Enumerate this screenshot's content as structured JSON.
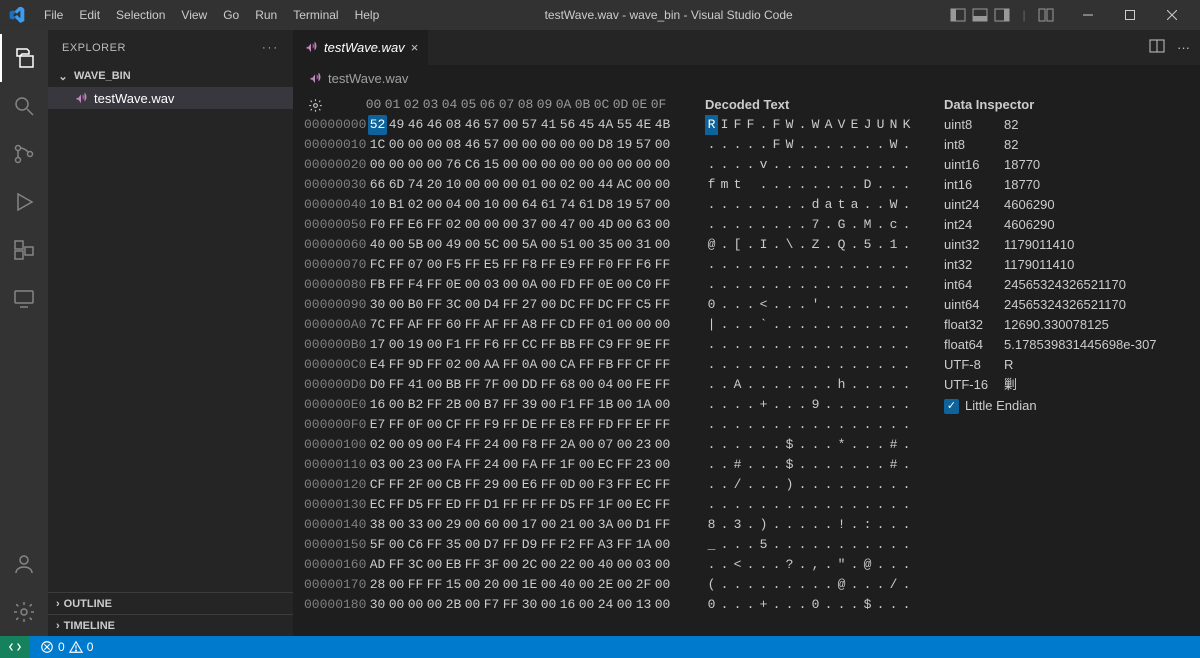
{
  "window": {
    "title": "testWave.wav - wave_bin - Visual Studio Code"
  },
  "menu": [
    "File",
    "Edit",
    "Selection",
    "View",
    "Go",
    "Run",
    "Terminal",
    "Help"
  ],
  "explorer": {
    "title": "EXPLORER",
    "folder": "WAVE_BIN",
    "file": "testWave.wav",
    "outline": "OUTLINE",
    "timeline": "TIMELINE"
  },
  "tab": {
    "label": "testWave.wav"
  },
  "breadcrumb": {
    "label": "testWave.wav"
  },
  "hex": {
    "headers": [
      "00",
      "01",
      "02",
      "03",
      "04",
      "05",
      "06",
      "07",
      "08",
      "09",
      "0A",
      "0B",
      "0C",
      "0D",
      "0E",
      "0F"
    ],
    "rows": [
      {
        "addr": "00000000",
        "bytes": [
          "52",
          "49",
          "46",
          "46",
          "08",
          "46",
          "57",
          "00",
          "57",
          "41",
          "56",
          "45",
          "4A",
          "55",
          "4E",
          "4B"
        ]
      },
      {
        "addr": "00000010",
        "bytes": [
          "1C",
          "00",
          "00",
          "00",
          "08",
          "46",
          "57",
          "00",
          "00",
          "00",
          "00",
          "00",
          "D8",
          "19",
          "57",
          "00"
        ]
      },
      {
        "addr": "00000020",
        "bytes": [
          "00",
          "00",
          "00",
          "00",
          "76",
          "C6",
          "15",
          "00",
          "00",
          "00",
          "00",
          "00",
          "00",
          "00",
          "00",
          "00"
        ]
      },
      {
        "addr": "00000030",
        "bytes": [
          "66",
          "6D",
          "74",
          "20",
          "10",
          "00",
          "00",
          "00",
          "01",
          "00",
          "02",
          "00",
          "44",
          "AC",
          "00",
          "00"
        ]
      },
      {
        "addr": "00000040",
        "bytes": [
          "10",
          "B1",
          "02",
          "00",
          "04",
          "00",
          "10",
          "00",
          "64",
          "61",
          "74",
          "61",
          "D8",
          "19",
          "57",
          "00"
        ]
      },
      {
        "addr": "00000050",
        "bytes": [
          "F0",
          "FF",
          "E6",
          "FF",
          "02",
          "00",
          "00",
          "00",
          "37",
          "00",
          "47",
          "00",
          "4D",
          "00",
          "63",
          "00"
        ]
      },
      {
        "addr": "00000060",
        "bytes": [
          "40",
          "00",
          "5B",
          "00",
          "49",
          "00",
          "5C",
          "00",
          "5A",
          "00",
          "51",
          "00",
          "35",
          "00",
          "31",
          "00"
        ]
      },
      {
        "addr": "00000070",
        "bytes": [
          "FC",
          "FF",
          "07",
          "00",
          "F5",
          "FF",
          "E5",
          "FF",
          "F8",
          "FF",
          "E9",
          "FF",
          "F0",
          "FF",
          "F6",
          "FF"
        ]
      },
      {
        "addr": "00000080",
        "bytes": [
          "FB",
          "FF",
          "F4",
          "FF",
          "0E",
          "00",
          "03",
          "00",
          "0A",
          "00",
          "FD",
          "FF",
          "0E",
          "00",
          "C0",
          "FF"
        ]
      },
      {
        "addr": "00000090",
        "bytes": [
          "30",
          "00",
          "B0",
          "FF",
          "3C",
          "00",
          "D4",
          "FF",
          "27",
          "00",
          "DC",
          "FF",
          "DC",
          "FF",
          "C5",
          "FF"
        ]
      },
      {
        "addr": "000000A0",
        "bytes": [
          "7C",
          "FF",
          "AF",
          "FF",
          "60",
          "FF",
          "AF",
          "FF",
          "A8",
          "FF",
          "CD",
          "FF",
          "01",
          "00",
          "00",
          "00"
        ]
      },
      {
        "addr": "000000B0",
        "bytes": [
          "17",
          "00",
          "19",
          "00",
          "F1",
          "FF",
          "F6",
          "FF",
          "CC",
          "FF",
          "BB",
          "FF",
          "C9",
          "FF",
          "9E",
          "FF"
        ]
      },
      {
        "addr": "000000C0",
        "bytes": [
          "E4",
          "FF",
          "9D",
          "FF",
          "02",
          "00",
          "AA",
          "FF",
          "0A",
          "00",
          "CA",
          "FF",
          "FB",
          "FF",
          "CF",
          "FF"
        ]
      },
      {
        "addr": "000000D0",
        "bytes": [
          "D0",
          "FF",
          "41",
          "00",
          "BB",
          "FF",
          "7F",
          "00",
          "DD",
          "FF",
          "68",
          "00",
          "04",
          "00",
          "FE",
          "FF"
        ]
      },
      {
        "addr": "000000E0",
        "bytes": [
          "16",
          "00",
          "B2",
          "FF",
          "2B",
          "00",
          "B7",
          "FF",
          "39",
          "00",
          "F1",
          "FF",
          "1B",
          "00",
          "1A",
          "00"
        ]
      },
      {
        "addr": "000000F0",
        "bytes": [
          "E7",
          "FF",
          "0F",
          "00",
          "CF",
          "FF",
          "F9",
          "FF",
          "DE",
          "FF",
          "E8",
          "FF",
          "FD",
          "FF",
          "EF",
          "FF"
        ]
      },
      {
        "addr": "00000100",
        "bytes": [
          "02",
          "00",
          "09",
          "00",
          "F4",
          "FF",
          "24",
          "00",
          "F8",
          "FF",
          "2A",
          "00",
          "07",
          "00",
          "23",
          "00"
        ]
      },
      {
        "addr": "00000110",
        "bytes": [
          "03",
          "00",
          "23",
          "00",
          "FA",
          "FF",
          "24",
          "00",
          "FA",
          "FF",
          "1F",
          "00",
          "EC",
          "FF",
          "23",
          "00"
        ]
      },
      {
        "addr": "00000120",
        "bytes": [
          "CF",
          "FF",
          "2F",
          "00",
          "CB",
          "FF",
          "29",
          "00",
          "E6",
          "FF",
          "0D",
          "00",
          "F3",
          "FF",
          "EC",
          "FF"
        ]
      },
      {
        "addr": "00000130",
        "bytes": [
          "EC",
          "FF",
          "D5",
          "FF",
          "ED",
          "FF",
          "D1",
          "FF",
          "FF",
          "FF",
          "D5",
          "FF",
          "1F",
          "00",
          "EC",
          "FF"
        ]
      },
      {
        "addr": "00000140",
        "bytes": [
          "38",
          "00",
          "33",
          "00",
          "29",
          "00",
          "60",
          "00",
          "17",
          "00",
          "21",
          "00",
          "3A",
          "00",
          "D1",
          "FF"
        ]
      },
      {
        "addr": "00000150",
        "bytes": [
          "5F",
          "00",
          "C6",
          "FF",
          "35",
          "00",
          "D7",
          "FF",
          "D9",
          "FF",
          "F2",
          "FF",
          "A3",
          "FF",
          "1A",
          "00"
        ]
      },
      {
        "addr": "00000160",
        "bytes": [
          "AD",
          "FF",
          "3C",
          "00",
          "EB",
          "FF",
          "3F",
          "00",
          "2C",
          "00",
          "22",
          "00",
          "40",
          "00",
          "03",
          "00"
        ]
      },
      {
        "addr": "00000170",
        "bytes": [
          "28",
          "00",
          "FF",
          "FF",
          "15",
          "00",
          "20",
          "00",
          "1E",
          "00",
          "40",
          "00",
          "2E",
          "00",
          "2F",
          "00"
        ]
      },
      {
        "addr": "00000180",
        "bytes": [
          "30",
          "00",
          "00",
          "00",
          "2B",
          "00",
          "F7",
          "FF",
          "30",
          "00",
          "16",
          "00",
          "24",
          "00",
          "13",
          "00"
        ]
      }
    ],
    "selected": {
      "row": 0,
      "col": 0
    }
  },
  "decoded": {
    "title": "Decoded Text",
    "rows": [
      [
        "R",
        "I",
        "F",
        "F",
        ".",
        "F",
        "W",
        ".",
        "W",
        "A",
        "V",
        "E",
        "J",
        "U",
        "N",
        "K"
      ],
      [
        ".",
        ".",
        ".",
        ".",
        ".",
        "F",
        "W",
        ".",
        ".",
        ".",
        ".",
        ".",
        ".",
        ".",
        "W",
        "."
      ],
      [
        ".",
        ".",
        ".",
        ".",
        "v",
        ".",
        ".",
        ".",
        ".",
        ".",
        ".",
        ".",
        ".",
        ".",
        ".",
        "."
      ],
      [
        "f",
        "m",
        "t",
        " ",
        ".",
        ".",
        ".",
        ".",
        ".",
        ".",
        ".",
        ".",
        "D",
        ".",
        ".",
        "."
      ],
      [
        ".",
        ".",
        ".",
        ".",
        ".",
        ".",
        ".",
        ".",
        "d",
        "a",
        "t",
        "a",
        ".",
        ".",
        "W",
        "."
      ],
      [
        ".",
        ".",
        ".",
        ".",
        ".",
        ".",
        ".",
        ".",
        "7",
        ".",
        "G",
        ".",
        "M",
        ".",
        "c",
        "."
      ],
      [
        "@",
        ".",
        "[",
        ".",
        "I",
        ".",
        "\\",
        ".",
        "Z",
        ".",
        "Q",
        ".",
        "5",
        ".",
        "1",
        "."
      ],
      [
        ".",
        ".",
        ".",
        ".",
        ".",
        ".",
        ".",
        ".",
        ".",
        ".",
        ".",
        ".",
        ".",
        ".",
        ".",
        "."
      ],
      [
        ".",
        ".",
        ".",
        ".",
        ".",
        ".",
        ".",
        ".",
        ".",
        ".",
        ".",
        ".",
        ".",
        ".",
        ".",
        "."
      ],
      [
        "0",
        ".",
        ".",
        ".",
        "<",
        ".",
        ".",
        ".",
        "'",
        ".",
        ".",
        ".",
        ".",
        ".",
        ".",
        "."
      ],
      [
        "|",
        ".",
        ".",
        ".",
        "`",
        ".",
        ".",
        ".",
        ".",
        ".",
        ".",
        ".",
        ".",
        ".",
        ".",
        "."
      ],
      [
        ".",
        ".",
        ".",
        ".",
        ".",
        ".",
        ".",
        ".",
        ".",
        ".",
        ".",
        ".",
        ".",
        ".",
        ".",
        "."
      ],
      [
        ".",
        ".",
        ".",
        ".",
        ".",
        ".",
        ".",
        ".",
        ".",
        ".",
        ".",
        ".",
        ".",
        ".",
        ".",
        "."
      ],
      [
        ".",
        ".",
        "A",
        ".",
        ".",
        ".",
        ".",
        ".",
        ".",
        ".",
        "h",
        ".",
        ".",
        ".",
        ".",
        "."
      ],
      [
        ".",
        ".",
        ".",
        ".",
        "+",
        ".",
        ".",
        ".",
        "9",
        ".",
        ".",
        ".",
        ".",
        ".",
        ".",
        "."
      ],
      [
        ".",
        ".",
        ".",
        ".",
        ".",
        ".",
        ".",
        ".",
        ".",
        ".",
        ".",
        ".",
        ".",
        ".",
        ".",
        "."
      ],
      [
        ".",
        ".",
        ".",
        ".",
        ".",
        ".",
        "$",
        ".",
        ".",
        ".",
        "*",
        ".",
        ".",
        ".",
        "#",
        "."
      ],
      [
        ".",
        ".",
        "#",
        ".",
        ".",
        ".",
        "$",
        ".",
        ".",
        ".",
        ".",
        ".",
        ".",
        ".",
        "#",
        "."
      ],
      [
        ".",
        ".",
        "/",
        ".",
        ".",
        ".",
        ")",
        ".",
        ".",
        ".",
        ".",
        ".",
        ".",
        ".",
        ".",
        "."
      ],
      [
        ".",
        ".",
        ".",
        ".",
        ".",
        ".",
        ".",
        ".",
        ".",
        ".",
        ".",
        ".",
        ".",
        ".",
        ".",
        "."
      ],
      [
        "8",
        ".",
        "3",
        ".",
        ")",
        ".",
        ".",
        ".",
        ".",
        ".",
        "!",
        ".",
        ":",
        ".",
        ".",
        "."
      ],
      [
        "_",
        ".",
        ".",
        ".",
        "5",
        ".",
        ".",
        ".",
        ".",
        ".",
        ".",
        ".",
        ".",
        ".",
        ".",
        "."
      ],
      [
        ".",
        ".",
        "<",
        ".",
        ".",
        ".",
        "?",
        ".",
        ",",
        ".",
        "\"",
        ".",
        "@",
        ".",
        ".",
        "."
      ],
      [
        "(",
        ".",
        ".",
        ".",
        ".",
        ".",
        ".",
        ".",
        ".",
        ".",
        "@",
        ".",
        ".",
        ".",
        "/",
        "."
      ],
      [
        "0",
        ".",
        ".",
        ".",
        "+",
        ".",
        ".",
        ".",
        "0",
        ".",
        ".",
        ".",
        "$",
        ".",
        ".",
        "."
      ]
    ]
  },
  "inspector": {
    "title": "Data Inspector",
    "items": [
      {
        "k": "uint8",
        "v": "82"
      },
      {
        "k": "int8",
        "v": "82"
      },
      {
        "k": "uint16",
        "v": "18770"
      },
      {
        "k": "int16",
        "v": "18770"
      },
      {
        "k": "uint24",
        "v": "4606290"
      },
      {
        "k": "int24",
        "v": "4606290"
      },
      {
        "k": "uint32",
        "v": "1179011410"
      },
      {
        "k": "int32",
        "v": "1179011410"
      },
      {
        "k": "int64",
        "v": "24565324326521170"
      },
      {
        "k": "uint64",
        "v": "24565324326521170"
      },
      {
        "k": "float32",
        "v": "12690.330078125"
      },
      {
        "k": "float64",
        "v": "5.178539831445698e-307"
      },
      {
        "k": "UTF-8",
        "v": "R"
      },
      {
        "k": "UTF-16",
        "v": "剿"
      }
    ],
    "endian_label": "Little Endian"
  },
  "statusbar": {
    "errors": "0",
    "warnings": "0"
  }
}
